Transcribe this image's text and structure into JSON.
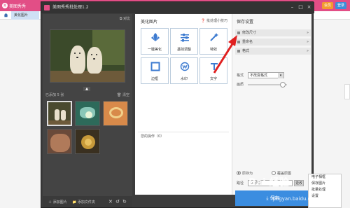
{
  "app": {
    "name": "美图秀秀",
    "tab": "美化图片",
    "buttons": [
      "会员",
      "登录"
    ]
  },
  "dialog": {
    "title": "美图秀秀批处理1.2",
    "compare": "对比"
  },
  "left_panel": {
    "added_count": "已添加 5 张",
    "clear": "清空",
    "add_image": "添加图片",
    "add_folder": "添加文件夹"
  },
  "middle_panel": {
    "heading": "美化图片",
    "help": "批处理小技巧",
    "tools": [
      {
        "label": "一键美化",
        "icon": "beautify-icon"
      },
      {
        "label": "基础调整",
        "icon": "sliders-icon"
      },
      {
        "label": "特效",
        "icon": "magic-wand-icon"
      },
      {
        "label": "边框",
        "icon": "frame-icon"
      },
      {
        "label": "水印",
        "icon": "watermark-icon"
      },
      {
        "label": "文字",
        "icon": "text-icon"
      }
    ],
    "history": "您的操作（0）"
  },
  "right_panel": {
    "heading": "保存设置",
    "rows": [
      "修改尺寸",
      "重命名",
      "格式"
    ],
    "format_label": "格式",
    "format_value": "不改变格式",
    "quality_label": "画质",
    "radio_original": "原存为",
    "radio_overwrite": "覆盖原图",
    "path_label": "路径",
    "path_value": "D:\\桌面",
    "browse": "更改",
    "save": "保存"
  },
  "context_menu": [
    "电子相框",
    "保存图片",
    "批量处理",
    "设置"
  ],
  "watermark": {
    "logo": "Bai 经验",
    "url": "jingyan.baidu.com"
  },
  "colors": {
    "accent": "#e24e86",
    "save_blue": "#3b8de0",
    "arrow_red": "#e02020"
  }
}
